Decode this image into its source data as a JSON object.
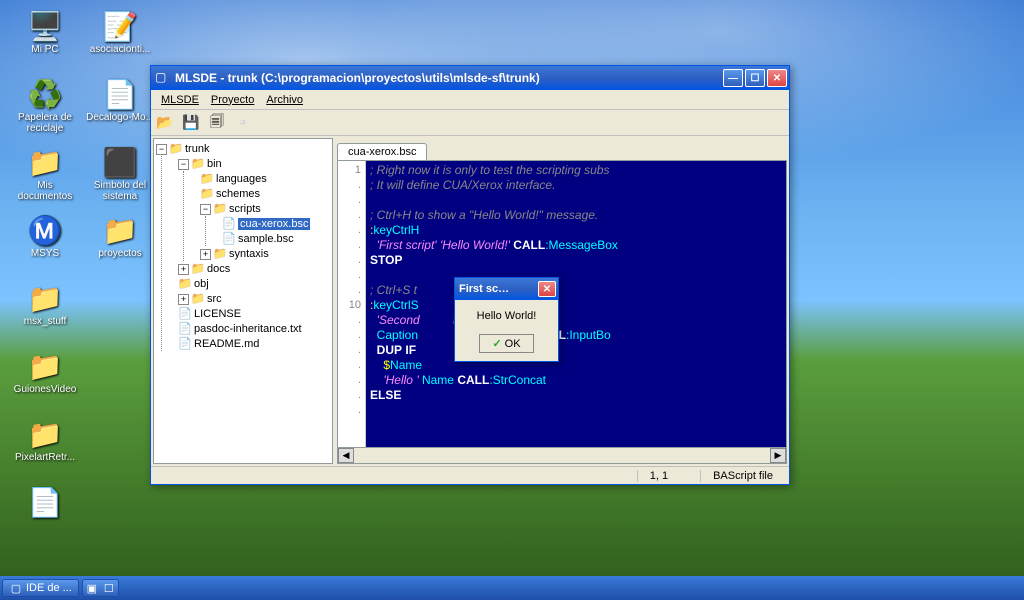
{
  "desktop_icons_col1": [
    {
      "label": "Mi PC",
      "glyph": "🖥️"
    },
    {
      "label": "Papelera de reciclaje",
      "glyph": "♻️"
    },
    {
      "label": "Mis documentos",
      "glyph": "📁"
    },
    {
      "label": "MSYS",
      "glyph": "Ⓜ️"
    },
    {
      "label": "msx_stuff",
      "glyph": "📁"
    },
    {
      "label": "GuionesVideo",
      "glyph": "📁"
    },
    {
      "label": "PixelartRetr...",
      "glyph": "📁"
    },
    {
      "label": "",
      "glyph": "📄"
    }
  ],
  "desktop_icons_col2": [
    {
      "label": "asociacionti...",
      "glyph": "📝"
    },
    {
      "label": "Decalogo-Mo...",
      "glyph": "📄"
    },
    {
      "label": "Simbolo del sistema",
      "glyph": "⬛"
    },
    {
      "label": "proyectos",
      "glyph": "📁"
    }
  ],
  "window": {
    "title": "MLSDE - trunk (C:\\programacion\\proyectos\\utils\\mlsde-sf\\trunk)",
    "menus": [
      "MLSDE",
      "Proyecto",
      "Archivo"
    ],
    "tab": "cua-xerox.bsc",
    "status_pos": "1, 1",
    "status_type": "BAScript file"
  },
  "tree": {
    "root": "trunk",
    "bin": "bin",
    "languages": "languages",
    "schemes": "schemes",
    "scripts": "scripts",
    "cua": "cua-xerox.bsc",
    "sample": "sample.bsc",
    "syntaxis": "syntaxis",
    "docs": "docs",
    "obj": "obj",
    "src": "src",
    "license": "LICENSE",
    "pasdoc": "pasdoc-inheritance.txt",
    "readme": "README.md"
  },
  "gutter": [
    "1",
    ".",
    ".",
    ".",
    ".",
    ".",
    ".",
    ".",
    ".",
    "10",
    ".",
    ".",
    ".",
    ".",
    ".",
    ".",
    "."
  ],
  "code_lines": [
    {
      "t": "comment",
      "text": "; Right now it is only to test the scripting subs"
    },
    {
      "t": "comment",
      "text": "; It will define CUA/Xerox interface."
    },
    {
      "t": "blank",
      "text": ""
    },
    {
      "t": "comment",
      "text": "; Ctrl+H to show a \"Hello World!\" message."
    },
    {
      "t": "label",
      "pre": ":",
      "text": "keyCtrlH"
    },
    {
      "t": "call",
      "s1": "'First script'",
      "s2": "'Hello World!'",
      "kw": "CALL",
      "fn": ":MessageBox"
    },
    {
      "t": "kw",
      "text": "STOP"
    },
    {
      "t": "blank",
      "text": ""
    },
    {
      "t": "comment",
      "text": "; Ctrl+S t"
    },
    {
      "t": "label",
      "pre": ":",
      "text": "keyCtrlS"
    },
    {
      "t": "call2",
      "s1": "'Second",
      "s2": "tion"
    },
    {
      "t": "call3",
      "kw1": "Caption",
      "s2": "'s your name:\"",
      "kw": "CALL",
      "fn": ":InputBo"
    },
    {
      "t": "dup",
      "kw1": "DUP",
      "kw2": "IF"
    },
    {
      "t": "var",
      "pre": "$",
      "text": "Name"
    },
    {
      "t": "concat",
      "s1": "'Hello '",
      "id": "Name",
      "kw": "CALL",
      "fn": ":StrConcat"
    },
    {
      "t": "kw",
      "text": "ELSE"
    }
  ],
  "dialog": {
    "title": "First sc…",
    "message": "Hello World!",
    "ok": "OK"
  },
  "taskbar": {
    "item": "IDE de ..."
  }
}
